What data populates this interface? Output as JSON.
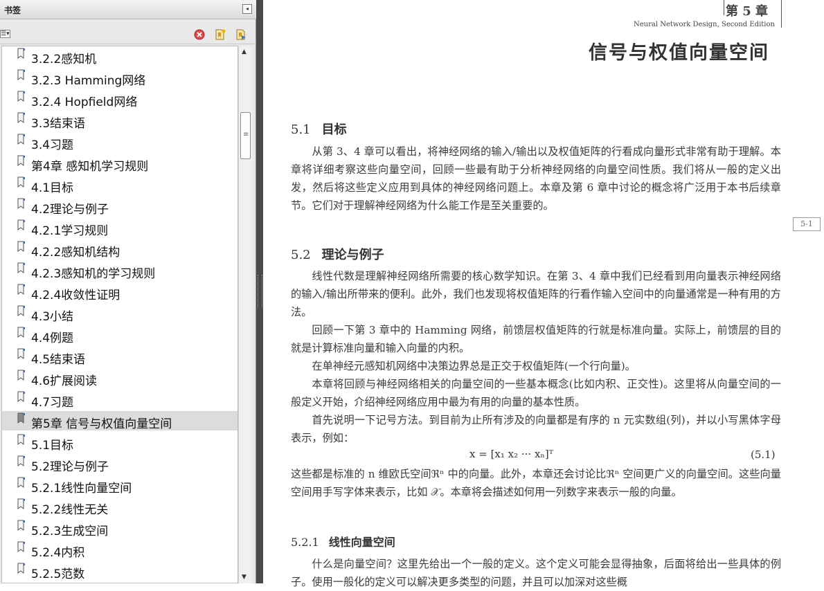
{
  "panel": {
    "title": "书签",
    "collapse_glyph": "◂",
    "options_glyph": "☰▾"
  },
  "bookmarks": [
    {
      "label": "3.2.2感知机"
    },
    {
      "label": "3.2.3  Hamming网络"
    },
    {
      "label": "3.2.4  Hopfield网络"
    },
    {
      "label": "3.3结束语"
    },
    {
      "label": "3.4习题"
    },
    {
      "label": "第4章  感知机学习规则"
    },
    {
      "label": "4.1目标"
    },
    {
      "label": "4.2理论与例子"
    },
    {
      "label": "4.2.1学习规则"
    },
    {
      "label": "4.2.2感知机结构"
    },
    {
      "label": "4.2.3感知机的学习规则"
    },
    {
      "label": "4.2.4收敛性证明"
    },
    {
      "label": "4.3小结"
    },
    {
      "label": "4.4例题"
    },
    {
      "label": "4.5结束语"
    },
    {
      "label": "4.6扩展阅读"
    },
    {
      "label": "4.7习题"
    },
    {
      "label": "第5章  信号与权值向量空间",
      "selected": true
    },
    {
      "label": "5.1目标"
    },
    {
      "label": "5.2理论与例子"
    },
    {
      "label": "5.2.1线性向量空间"
    },
    {
      "label": "5.2.2线性无关"
    },
    {
      "label": "5.2.3生成空间"
    },
    {
      "label": "5.2.4内积"
    },
    {
      "label": "5.2.5范数"
    }
  ],
  "document": {
    "chapter_label": "第 5 章",
    "running_head": "Neural Network Design, Second Edition",
    "chapter_title": "信号与权值向量空间",
    "page_tag": "5-1",
    "s51": {
      "num": "5.1",
      "title": "目标"
    },
    "p1": "从第 3、4 章可以看出，将神经网络的输入/输出以及权值矩阵的行看成向量形式非常有助于理解。本章将详细考察这些向量空间，回顾一些最有助于分析神经网络的向量空间性质。我们将从一般的定义出发，然后将这些定义应用到具体的神经网络问题上。本章及第 6 章中讨论的概念将广泛用于本书后续章节。它们对于理解神经网络为什么能工作是至关重要的。",
    "s52": {
      "num": "5.2",
      "title": "理论与例子"
    },
    "p2": "线性代数是理解神经网络所需要的核心数学知识。在第 3、4 章中我们已经看到用向量表示神经网络的输入/输出所带来的便利。此外，我们也发现将权值矩阵的行看作输入空间中的向量通常是一种有用的方法。",
    "p3": "回顾一下第 3 章中的 Hamming 网络，前馈层权值矩阵的行就是标准向量。实际上，前馈层的目的就是计算标准向量和输入向量的内积。",
    "p4": "在单神经元感知机网络中决策边界总是正交于权值矩阵(一个行向量)。",
    "p5": "本章将回顾与神经网络相关的向量空间的一些基本概念(比如内积、正交性)。这里将从向量空间的一般定义开始，介绍神经网络应用中最为有用的向量的基本性质。",
    "p6": "首先说明一下记号方法。到目前为止所有涉及的向量都是有序的 n 元实数组(列)，并以小写黑体字母表示，例如：",
    "equation": "x = [x₁   x₂   ···   xₙ]ᵀ",
    "equation_number": "(5.1)",
    "p7": "这些都是标准的 n 维欧氏空间ℜⁿ 中的向量。此外，本章还会讨论比ℜⁿ 空间更广义的向量空间。这些向量空间用手写字体来表示，比如 𝒳。本章将会描述如何用一列数字来表示一般的向量。",
    "s521": {
      "num": "5.2.1",
      "title": "线性向量空间"
    },
    "p8": "什么是向量空间？这里先给出一个一般的定义。这个定义可能会显得抽象，后面将给出一些具体的例子。使用一般化的定义可以解决更多类型的问题，并且可以加深对这些概"
  }
}
